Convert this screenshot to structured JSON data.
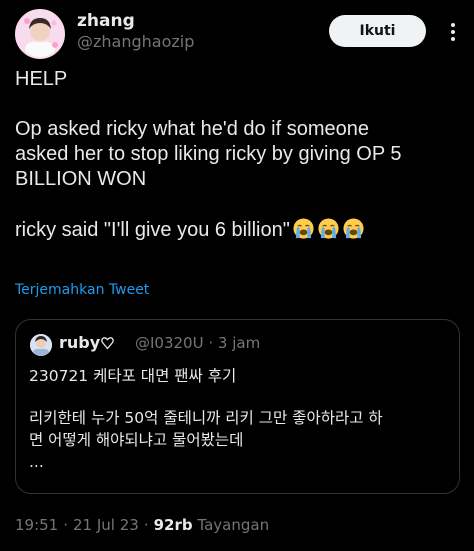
{
  "author": {
    "display_name": "zhang",
    "handle": "@zhanghaozip"
  },
  "follow_button": {
    "label": "Ikuti"
  },
  "tweet": {
    "lines": [
      "HELP",
      "Op asked ricky what he'd do if someone",
      "asked her to stop liking ricky by giving OP 5",
      "BILLION WON",
      "ricky said \"I'll give you 6 billion\""
    ],
    "emoji": [
      "loudly-crying-face-icon",
      "loudly-crying-face-icon",
      "loudly-crying-face-icon"
    ]
  },
  "translate_link": "Terjemahkan Tweet",
  "quote": {
    "name": "ruby",
    "handle": "@I0320U",
    "separator": "·",
    "time": "3 jam",
    "lines": [
      "230721 케타포 대면 팬싸 후기",
      "리키한테 누가 50억 줄테니까 리키 그만 좋아하라고 하",
      "면 어떻게 해야되냐고 물어봤는데",
      "..."
    ]
  },
  "footer": {
    "time": "19:51",
    "date": "21 Jul 23",
    "separator": "·",
    "views_count": "92rb",
    "views_label": "Tayangan"
  },
  "colors": {
    "background": "#000000",
    "text_primary": "#e7e9ea",
    "text_secondary": "#71767b",
    "link": "#1d9bf0",
    "border": "#2f3336",
    "button_bg": "#eff3f4"
  }
}
